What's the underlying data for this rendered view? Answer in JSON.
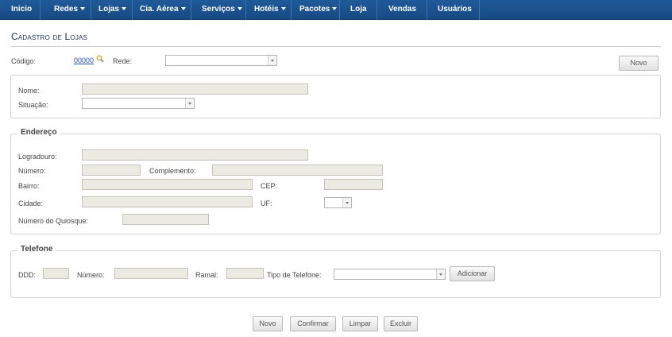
{
  "nav": {
    "items": [
      {
        "label": "Inicio",
        "dropdown": false
      },
      {
        "label": "Redes",
        "dropdown": true
      },
      {
        "label": "Lojas",
        "dropdown": true
      },
      {
        "label": "Cia. Aérea",
        "dropdown": true
      },
      {
        "label": "Serviços",
        "dropdown": true
      },
      {
        "label": "Hotéis",
        "dropdown": true
      },
      {
        "label": "Pacotes",
        "dropdown": true
      },
      {
        "label": "Loja",
        "dropdown": false
      },
      {
        "label": "Vendas",
        "dropdown": false
      },
      {
        "label": "Usuários",
        "dropdown": false
      }
    ]
  },
  "page": {
    "title": "Cadastro de Lojas"
  },
  "header_row": {
    "codigo_label": "Código:",
    "codigo_value": "00000",
    "rede_label": "Rede:",
    "rede_value": "",
    "novo_label": "Novo"
  },
  "basic": {
    "nome_label": "Nome:",
    "nome_value": "",
    "situacao_label": "Situação:",
    "situacao_value": ""
  },
  "endereco": {
    "legend": "Endereço",
    "logradouro_label": "Logradouro:",
    "numero_label": "Número:",
    "complemento_label": "Complemento:",
    "bairro_label": "Bairro:",
    "cep_label": "CEP:",
    "cidade_label": "Cidade:",
    "uf_label": "UF:",
    "quiosque_label": "Número do Quiosque:"
  },
  "telefone": {
    "legend": "Telefone",
    "ddd_label": "DDD:",
    "numero_label": "Número:",
    "ramal_label": "Ramal:",
    "tipo_label": "Tipo de Telefone:",
    "tipo_value": "",
    "adicionar_label": "Adicionar"
  },
  "footer": {
    "novo": "Novo",
    "confirmar": "Confirmar",
    "limpar": "Limpar",
    "excluir": "Excluir"
  },
  "colors": {
    "nav_bg": "#1f5a99",
    "title": "#1a2f4e",
    "link": "#1f4f9e"
  }
}
